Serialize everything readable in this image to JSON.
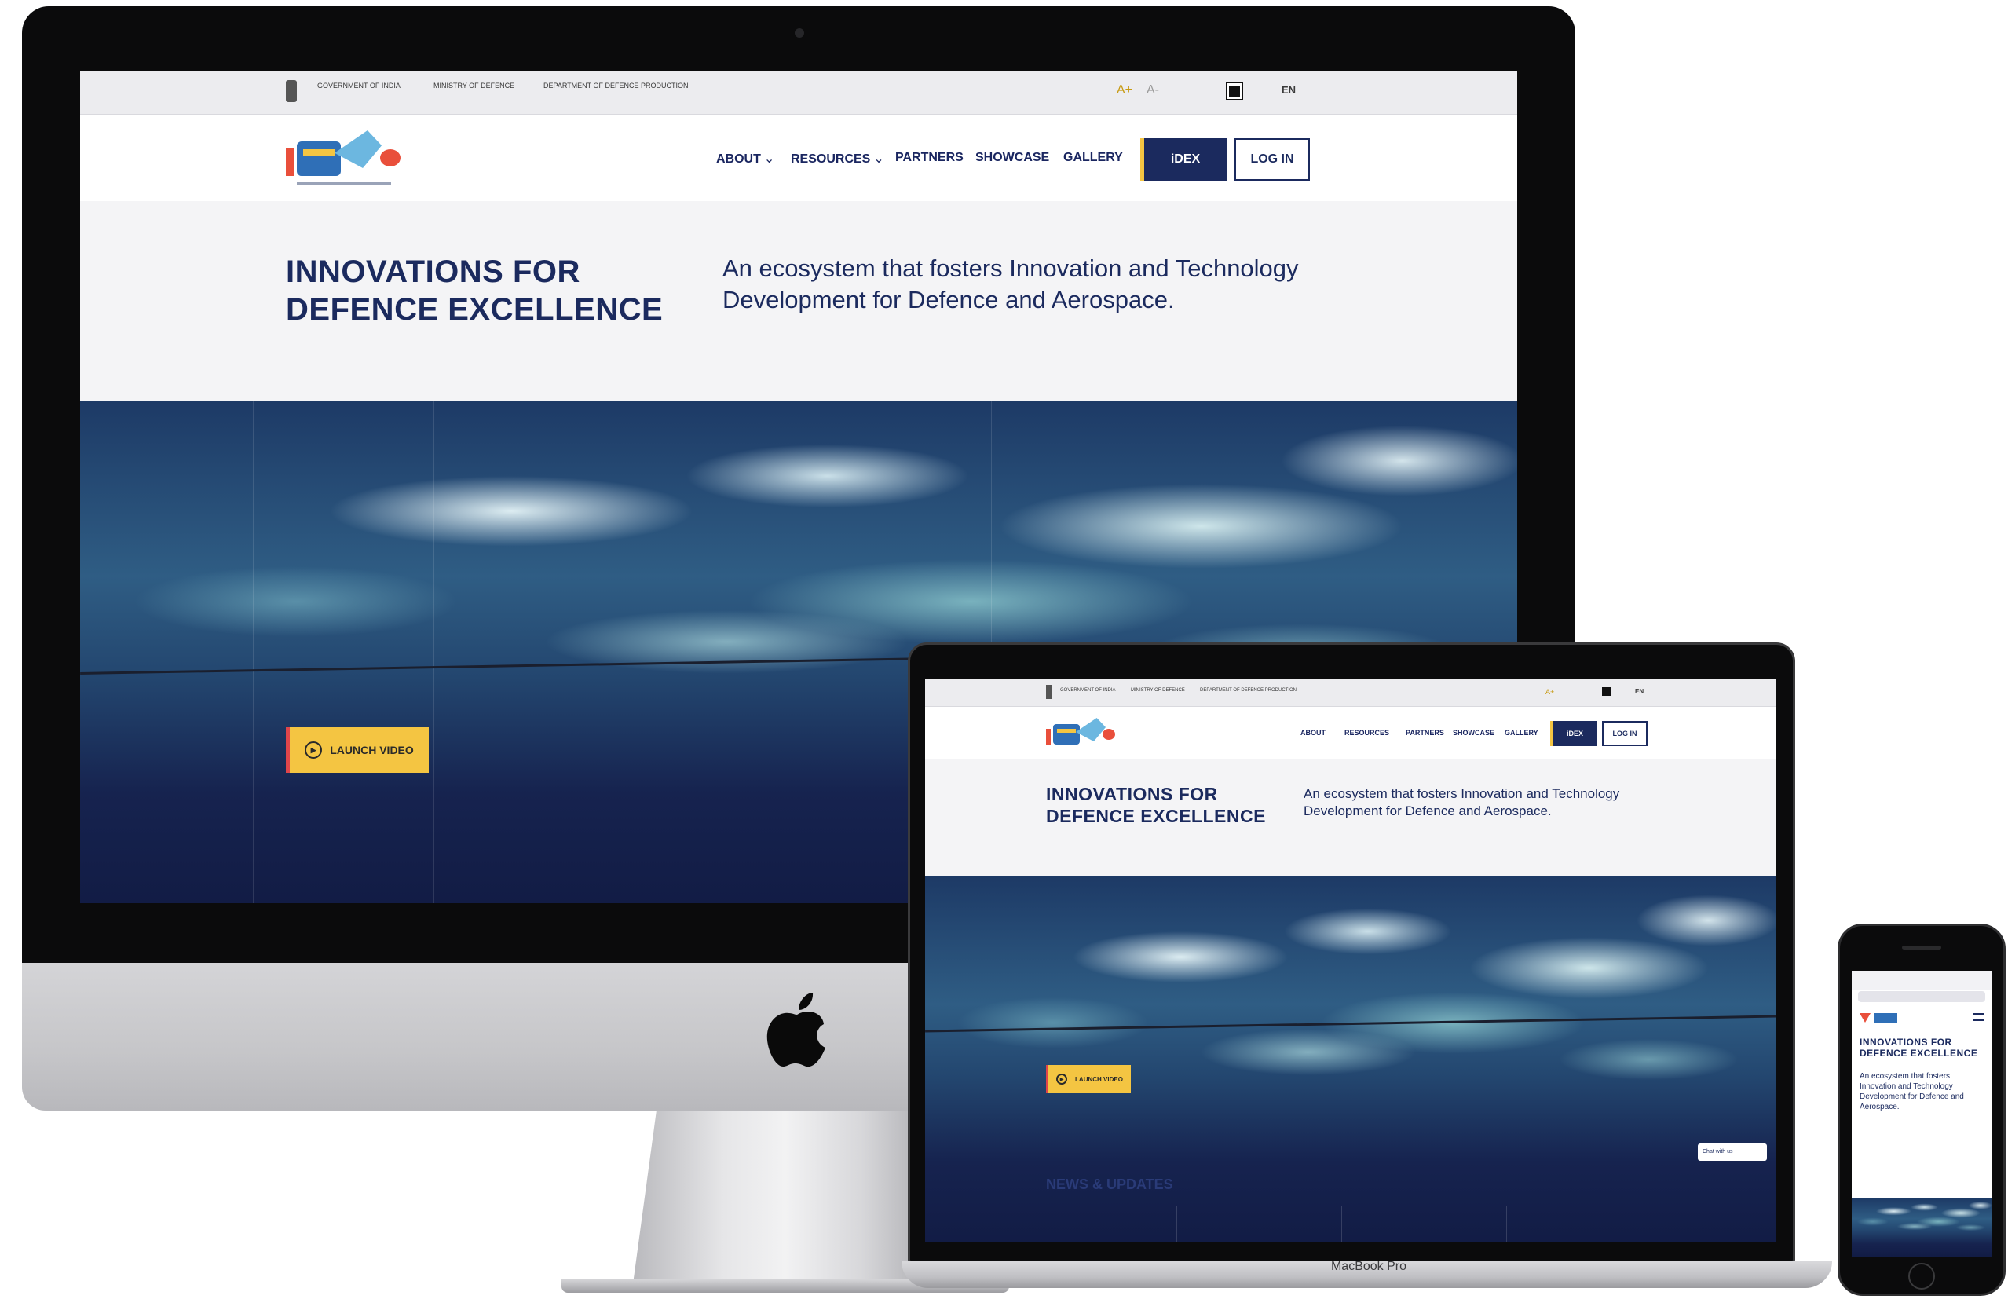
{
  "gov_bar": {
    "org1": "GOVERNMENT OF INDIA",
    "org2": "MINISTRY OF DEFENCE",
    "org3": "DEPARTMENT OF DEFENCE PRODUCTION",
    "text_increase": "A+",
    "text_decrease": "A-",
    "language": "EN"
  },
  "nav": {
    "about": "ABOUT",
    "resources": "RESOURCES",
    "partners": "PARTNERS",
    "showcase": "SHOWCASE",
    "gallery": "GALLERY",
    "idex_button": "iDEX",
    "login_button": "LOG IN"
  },
  "hero": {
    "title_line1": "INNOVATIONS FOR",
    "title_line2": "DEFENCE EXCELLENCE",
    "subtitle_line1": "An ecosystem that fosters Innovation and Technology",
    "subtitle_line2": "Development for Defence and Aerospace.",
    "video_button": "LAUNCH VIDEO"
  },
  "laptop": {
    "section_heading": "NEWS & UPDATES",
    "chat_widget": "Chat with us",
    "brand_label": "MacBook Pro"
  },
  "phone": {
    "title": "INNOVATIONS FOR DEFENCE EXCELLENCE",
    "subtitle": "An ecosystem that fosters Innovation and Technology Development for Defence and Aerospace."
  },
  "colors": {
    "brand_navy": "#1b2a5e",
    "accent_yellow": "#f4c542",
    "accent_red": "#e0454a"
  },
  "icons": [
    "emblem-icon",
    "play-icon",
    "contrast-icon",
    "apple-logo-icon",
    "chevron-down-icon",
    "menu-icon"
  ]
}
